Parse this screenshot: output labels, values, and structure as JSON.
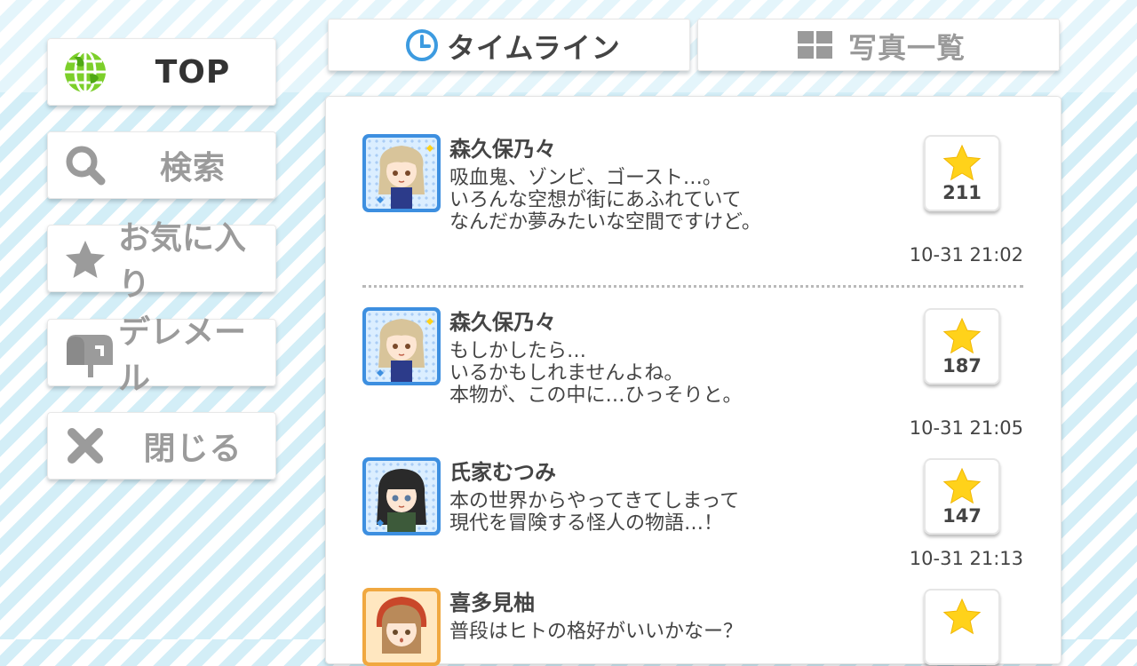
{
  "sidebar": {
    "top": {
      "label": "TOP",
      "icon": "globe-icon"
    },
    "search": {
      "label": "検索",
      "icon": "search-icon"
    },
    "favorites": {
      "label": "お気に入り",
      "icon": "star-icon"
    },
    "mail": {
      "label": "デレメール",
      "icon": "mailbox-icon"
    },
    "close": {
      "label": "閉じる",
      "icon": "close-icon"
    }
  },
  "tabs": {
    "timeline": {
      "label": "タイムライン",
      "icon": "clock-icon",
      "active": true
    },
    "photos": {
      "label": "写真一覧",
      "icon": "grid-icon",
      "active": false
    }
  },
  "posts": [
    {
      "name": "森久保乃々",
      "lines": [
        "吸血鬼、ゾンビ、ゴースト…。",
        "いろんな空想が街にあふれていて",
        "なんだか夢みたいな空間ですけど。"
      ],
      "likes": "211",
      "time": "10-31 21:02"
    },
    {
      "name": "森久保乃々",
      "lines": [
        "もしかしたら…",
        "いるかもしれませんよね。",
        "本物が、この中に…ひっそりと。"
      ],
      "likes": "187",
      "time": "10-31 21:05"
    },
    {
      "name": "氏家むつみ",
      "lines": [
        "本の世界からやってきてしまって",
        "現代を冒険する怪人の物語…！"
      ],
      "likes": "147",
      "time": "10-31 21:13"
    },
    {
      "name": "喜多見柚",
      "lines": [
        "普段はヒトの格好がいいかなー？"
      ],
      "likes": "",
      "time": ""
    }
  ],
  "colors": {
    "accent": "#3d9be0",
    "star": "#ffd21a",
    "globe": "#7ccf2a",
    "icon_grey": "#9b9b9b"
  }
}
